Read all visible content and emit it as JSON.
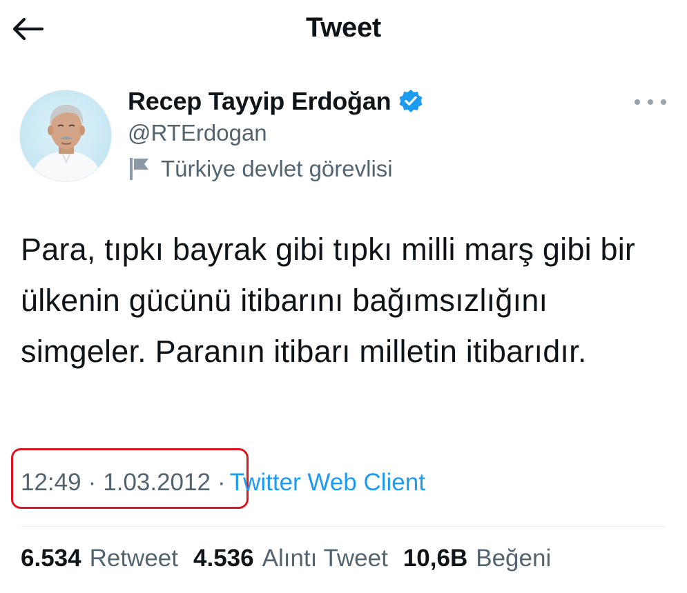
{
  "header": {
    "title": "Tweet",
    "back_icon": "arrow-left-icon"
  },
  "author": {
    "name": "Recep Tayyip Erdoğan",
    "handle": "@RTErdogan",
    "verified_icon": "verified-badge-icon",
    "label": "Türkiye devlet görevlisi",
    "label_icon": "flag-icon",
    "more_icon": "more-horizontal-icon"
  },
  "tweet": {
    "text": "Para, tıpkı bayrak gibi tıpkı milli marş gibi bir ülkenin gücünü itibarını bağımsızlığını simgeler. Paranın itibarı milletin itibarıdır.",
    "time": "12:49",
    "date": "1.03.2012",
    "separator": "·",
    "source": "Twitter Web Client"
  },
  "stats": {
    "retweets": {
      "count": "6.534",
      "label": "Retweet"
    },
    "quotes": {
      "count": "4.536",
      "label": "Alıntı Tweet"
    },
    "likes": {
      "count": "10,6B",
      "label": "Beğeni"
    }
  },
  "colors": {
    "accent": "#1d9bf0",
    "secondary_text": "#536471",
    "highlight_box": "#e0141e"
  }
}
